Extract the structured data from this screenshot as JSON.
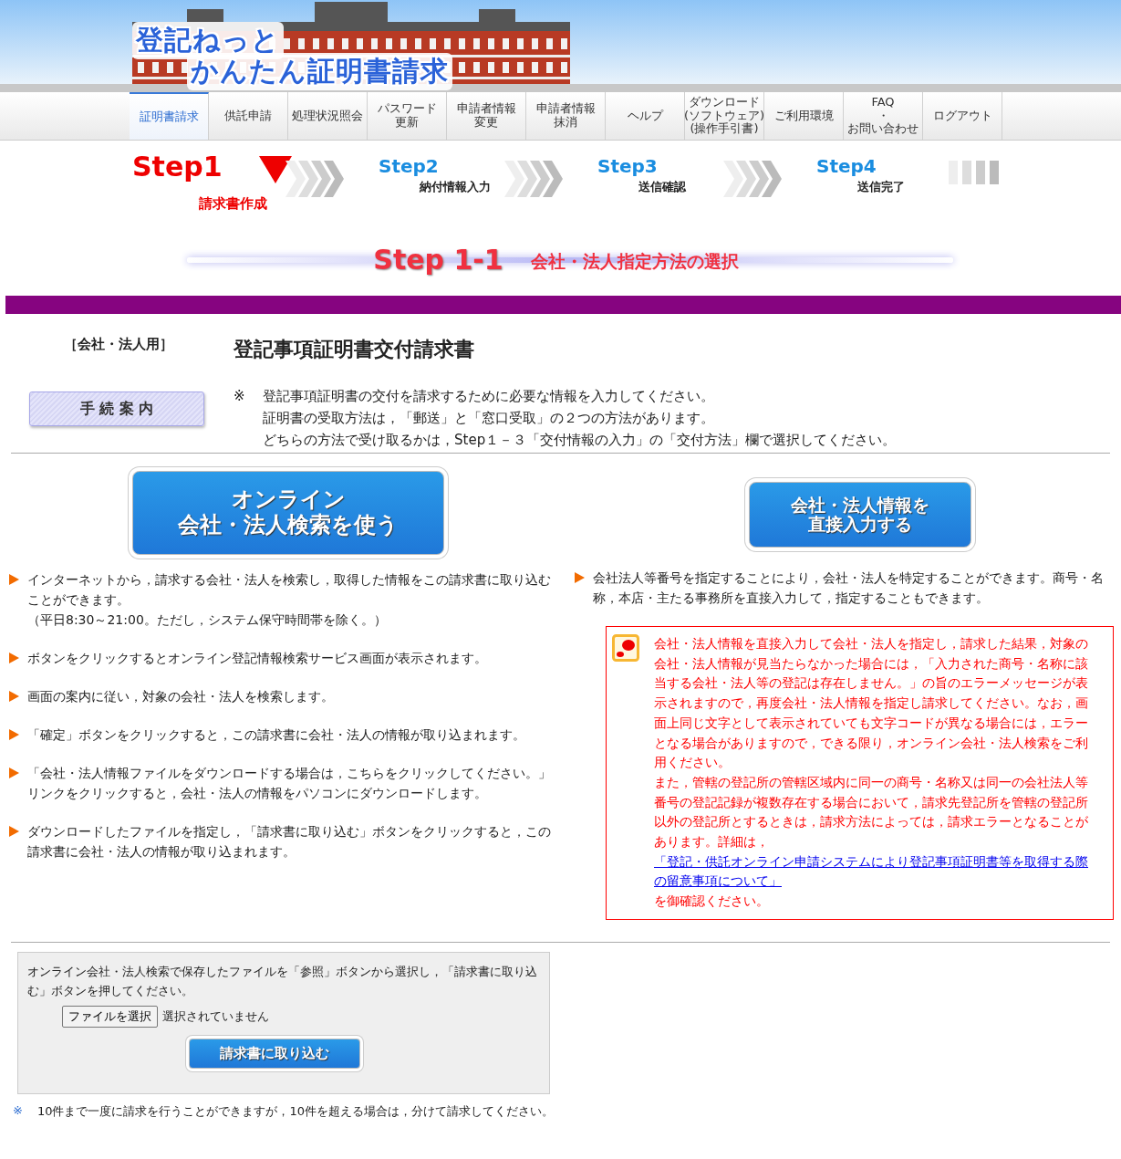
{
  "header": {
    "logo_line1": "登記ねっと",
    "logo_line2": "かんたん証明書請求"
  },
  "nav": [
    {
      "lines": [
        "証明書請求"
      ],
      "selected": true
    },
    {
      "lines": [
        "供託申請"
      ],
      "selected": false
    },
    {
      "lines": [
        "処理状況照会"
      ],
      "selected": false
    },
    {
      "lines": [
        "パスワード",
        "更新"
      ],
      "selected": false
    },
    {
      "lines": [
        "申請者情報",
        "変更"
      ],
      "selected": false
    },
    {
      "lines": [
        "申請者情報",
        "抹消"
      ],
      "selected": false
    },
    {
      "lines": [
        "ヘルプ"
      ],
      "selected": false
    },
    {
      "lines": [
        "ダウンロード",
        "(ソフトウェア)",
        "(操作手引書)"
      ],
      "selected": false
    },
    {
      "lines": [
        "ご利用環境"
      ],
      "selected": false
    },
    {
      "lines": [
        "FAQ",
        "・",
        "お問い合わせ"
      ],
      "selected": false
    },
    {
      "lines": [
        "ログアウト"
      ],
      "selected": false
    }
  ],
  "steps": [
    {
      "label": "Step1",
      "caption": "請求書作成",
      "current": true
    },
    {
      "label": "Step2",
      "caption": "納付情報入力",
      "current": false
    },
    {
      "label": "Step3",
      "caption": "送信確認",
      "current": false
    },
    {
      "label": "Step4",
      "caption": "送信完了",
      "current": false
    }
  ],
  "section_heading": {
    "step": "Step 1-1",
    "title": "会社・法人指定方法の選択"
  },
  "form": {
    "category": "［会社・法人用］",
    "title": "登記事項証明書交付請求書",
    "guide_button": "手 続 案 内",
    "note_mark": "※",
    "note_lines": [
      "登記事項証明書の交付を請求するために必要な情報を入力してください。",
      "証明書の受取方法は，「郵送」と「窓口受取」の２つの方法があります。",
      "どちらの方法で受け取るかは，Step１－３「交付情報の入力」の「交付方法」欄で選択してください。"
    ]
  },
  "online": {
    "button_lines": [
      "オンライン",
      "会社・法人検索を使う"
    ],
    "bullets": [
      {
        "lines": [
          "インターネットから，請求する会社・法人を検索し，取得した情報をこの請求書に取り込むことができます。",
          "（平日8:30～21:00。ただし，システム保守時間帯を除く。）"
        ]
      },
      {
        "lines": [
          "ボタンをクリックするとオンライン登記情報検索サービス画面が表示されます。"
        ]
      },
      {
        "lines": [
          "画面の案内に従い，対象の会社・法人を検索します。"
        ]
      },
      {
        "lines": [
          "「確定」ボタンをクリックすると，この請求書に会社・法人の情報が取り込まれます。"
        ]
      },
      {
        "lines": [
          "「会社・法人情報ファイルをダウンロードする場合は，こちらをクリックしてください。」リンクをクリックすると，会社・法人の情報をパソコンにダウンロードします。"
        ]
      },
      {
        "lines": [
          "ダウンロードしたファイルを指定し，「請求書に取り込む」ボタンをクリックすると，この請求書に会社・法人の情報が取り込まれます。"
        ]
      }
    ]
  },
  "direct": {
    "button_lines": [
      "会社・法人情報を",
      "直接入力する"
    ],
    "bullets": [
      {
        "lines": [
          "会社法人等番号を指定することにより，会社・法人を特定することができます。商号・名称，本店・主たる事務所を直接入力して，指定することもできます。"
        ]
      }
    ],
    "warning": {
      "paragraph": "会社・法人情報を直接入力して会社・法人を指定し，請求した結果，対象の会社・法人情報が見当たらなかった場合には，「入力された商号・名称に該当する会社・法人等の登記は存在しません。」の旨のエラーメッセージが表示されますので，再度会社・法人情報を指定し請求してください。なお，画面上同じ文字として表示されていても文字コードが異なる場合には，エラーとなる場合がありますので，できる限り，オンライン会社・法人検索をご利用ください。",
      "before_link": "また，管轄の登記所の管轄区域内に同一の商号・名称又は同一の会社法人等番号の登記記録が複数存在する場合において，請求先登記所を管轄の登記所以外の登記所とするときは，請求方法によっては，請求エラーとなることがあります。詳細は，",
      "link": "「登記・供託オンライン申請システムにより登記事項証明書等を取得する際の留意事項について」",
      "after_link": "を御確認ください。"
    }
  },
  "upload": {
    "instruction": "オンライン会社・法人検索で保存したファイルを「参照」ボタンから選択し，「請求書に取り込む」ボタンを押してください。",
    "file_button": "ファイルを選択",
    "file_status": "選択されていません",
    "submit": "請求書に取り込む"
  },
  "footnote": {
    "mark": "※",
    "text": "10件まで一度に請求を行うことができますが，10件を超える場合は，分けて請求してください。"
  }
}
